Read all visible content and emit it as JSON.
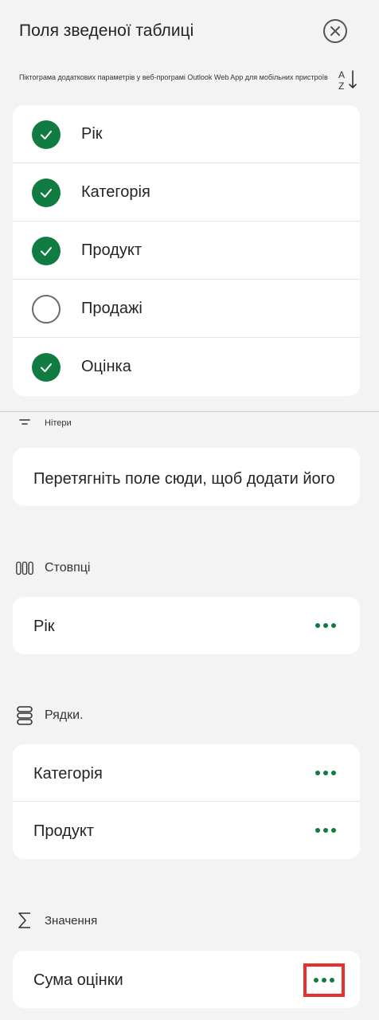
{
  "header": {
    "title": "Поля зведеної таблиці",
    "subtitle": "Піктограма додаткових параметрів у веб-програмі Outlook Web App для мобільних пристроїв"
  },
  "fields": [
    {
      "label": "Рік",
      "checked": true
    },
    {
      "label": "Категорія",
      "checked": true
    },
    {
      "label": "Продукт",
      "checked": true
    },
    {
      "label": "Продажі",
      "checked": false
    },
    {
      "label": "Оцінка",
      "checked": true
    }
  ],
  "filters": {
    "label": "Нітери",
    "drop_hint": "Перетягніть поле сюди, щоб додати його"
  },
  "columns": {
    "label": "Стовпці",
    "items": [
      "Рік"
    ]
  },
  "rows": {
    "label": "Рядки.",
    "items": [
      "Категорія",
      "Продукт"
    ]
  },
  "values": {
    "label": "Значення",
    "items": [
      "Сума оцінки"
    ]
  },
  "colors": {
    "accent": "#107c41",
    "highlight": "#e8302a"
  },
  "icons": {
    "close": "close-circle-icon",
    "sort": "sort-az-icon",
    "filter": "filter-icon",
    "columns": "columns-icon",
    "rows": "rows-icon",
    "values": "sigma-icon",
    "more": "more-horizontal-icon"
  }
}
